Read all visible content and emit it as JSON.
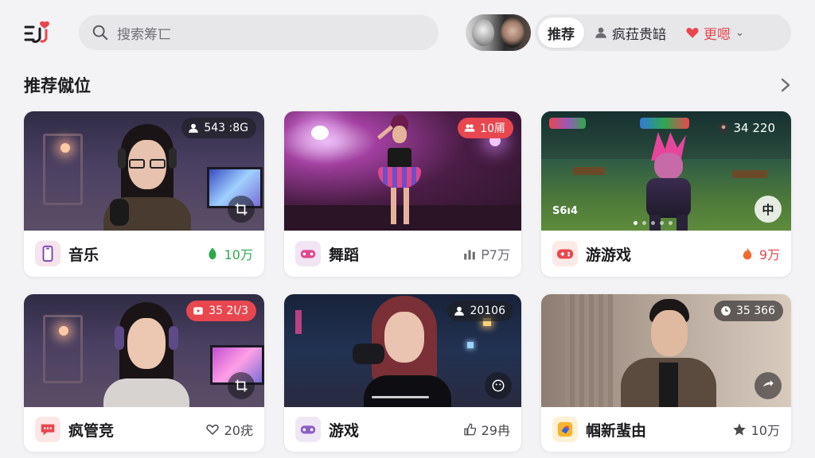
{
  "header": {
    "logo_icon": "app-logo-icon",
    "search_placeholder": "搜索筹匸",
    "tabs": [
      {
        "label": "推荐",
        "active": true
      },
      {
        "label": "疯菈贵䍌",
        "icon": "user-icon"
      },
      {
        "label": "更嗯",
        "icon": "heart-icon"
      }
    ]
  },
  "section": {
    "title": "推荐僦位"
  },
  "cards": [
    {
      "badge": "543 :8G",
      "badge_icon": "user-icon",
      "category": "音乐",
      "category_icon": "phone-icon",
      "stat": "10万",
      "stat_icon": "leaf-icon",
      "stat_color": "#2fa84f"
    },
    {
      "badge": "10㕊",
      "badge_icon": "group-icon",
      "badge_red": true,
      "category": "舞蹈",
      "category_icon": "gamepad-icon",
      "stat": "Ꮲ7万",
      "stat_icon": "bars-icon",
      "stat_color": "#6b6b70"
    },
    {
      "badge": "34 220",
      "badge_icon": "avatar-icon",
      "category": "游游戏",
      "category_icon": "gamepad-icon",
      "stat": "9万",
      "stat_icon": "fire-icon",
      "stat_color": "#e8474f",
      "thumb_text": "S6ı4",
      "thumb_label": "中"
    },
    {
      "badge": "35 2Ɩ/3",
      "badge_icon": "play-icon",
      "badge_red": true,
      "category": "疯管竞",
      "category_icon": "chat-icon",
      "stat": "20疣",
      "stat_icon": "heart-outline-icon",
      "stat_color": "#4a4a4f"
    },
    {
      "badge": "20106",
      "badge_icon": "user-icon",
      "category": "游戏",
      "category_icon": "gamepad-icon",
      "stat": "29冉",
      "stat_icon": "thumb-icon",
      "stat_color": "#4a4a4f"
    },
    {
      "badge": "35 366",
      "badge_icon": "clock-icon",
      "category": "帼新蜚由",
      "category_icon": "tag-icon",
      "stat": "10万",
      "stat_icon": "star-icon",
      "stat_color": "#4a4a4f"
    }
  ],
  "colors": {
    "accent": "#e8474f",
    "background": "#f3f3f5",
    "card": "#ffffff"
  }
}
